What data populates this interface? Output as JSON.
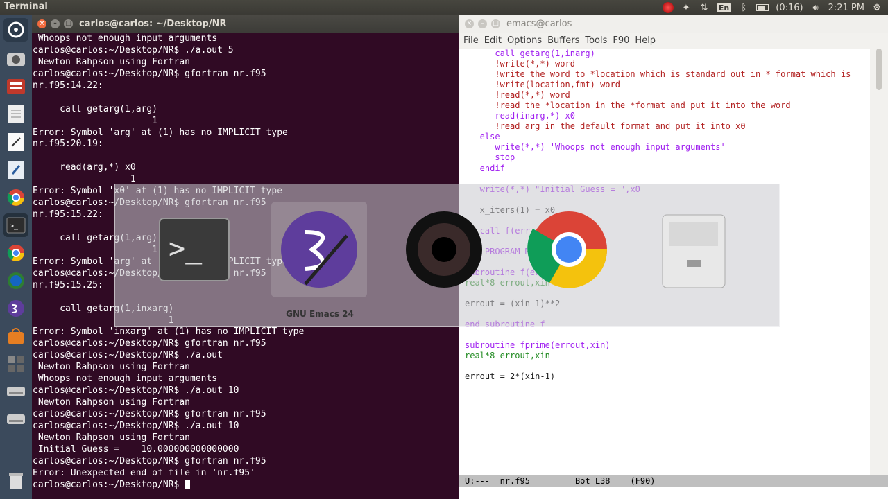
{
  "topbar": {
    "app_title": "Terminal",
    "battery": "(0:16)",
    "time": "2:21 PM",
    "keyboard": "En"
  },
  "terminal": {
    "title": "carlos@carlos: ~/Desktop/NR",
    "lines": [
      " Whoops not enough input arguments",
      "carlos@carlos:~/Desktop/NR$ ./a.out 5",
      " Newton Rahpson using Fortran",
      "carlos@carlos:~/Desktop/NR$ gfortran nr.f95",
      "nr.f95:14.22:",
      "",
      "     call getarg(1,arg)",
      "                      1",
      "Error: Symbol 'arg' at (1) has no IMPLICIT type",
      "nr.f95:20.19:",
      "",
      "     read(arg,*) x0",
      "                  1",
      "Error: Symbol 'x0' at (1) has no IMPLICIT type",
      "carlos@carlos:~/Desktop/NR$ gfortran nr.f95",
      "nr.f95:15.22:",
      "",
      "     call getarg(1,arg)",
      "                      1",
      "Error: Symbol 'arg' at (1) has no IMPLICIT type",
      "carlos@carlos:~/Desktop/NR$ gfortran nr.f95",
      "nr.f95:15.25:",
      "",
      "     call getarg(1,inxarg)",
      "                         1",
      "Error: Symbol 'inxarg' at (1) has no IMPLICIT type",
      "carlos@carlos:~/Desktop/NR$ gfortran nr.f95",
      "carlos@carlos:~/Desktop/NR$ ./a.out",
      " Newton Rahpson using Fortran",
      " Whoops not enough input arguments",
      "carlos@carlos:~/Desktop/NR$ ./a.out 10",
      " Newton Rahpson using Fortran",
      "carlos@carlos:~/Desktop/NR$ gfortran nr.f95",
      "carlos@carlos:~/Desktop/NR$ ./a.out 10",
      " Newton Rahpson using Fortran",
      " Initial Guess =    10.000000000000000",
      "carlos@carlos:~/Desktop/NR$ gfortran nr.f95",
      "Error: Unexpected end of file in 'nr.f95'"
    ],
    "prompt": "carlos@carlos:~/Desktop/NR$ "
  },
  "emacs": {
    "title": "emacs@carlos",
    "menu": [
      "File",
      "Edit",
      "Options",
      "Buffers",
      "Tools",
      "F90",
      "Help"
    ],
    "code": [
      "      call getarg(1,inarg)",
      "      !write(*,*) word",
      "      !write the word to *location which is standard out in * format which is",
      "      !write(location,fmt) word",
      "      !read(*,*) word",
      "      !read the *location in the *format and put it into the word",
      "      read(inarg,*) x0",
      "      !read arg in the default format and put it into x0",
      "   else",
      "      write(*,*) 'Whoops not enough input arguments'",
      "      stop",
      "   endif",
      "",
      "   write(*,*) \"Initial Guess = \",x0",
      "",
      "   x_iters(1) = x0",
      "",
      "   call f(err,x0)",
      "",
      "END PROGRAM MAIN",
      "",
      "subroutine f(errout,xin)",
      "real*8 errout,xin",
      "",
      "errout = (xin-1)**2",
      "",
      "end subroutine f",
      "",
      "subroutine fprime(errout,xin)",
      "real*8 errout,xin",
      "",
      "errout = 2*(xin-1)"
    ],
    "modeline": "U:---  nr.f95         Bot L38    (F90)"
  },
  "switcher": {
    "selected_label": "GNU Emacs 24"
  }
}
